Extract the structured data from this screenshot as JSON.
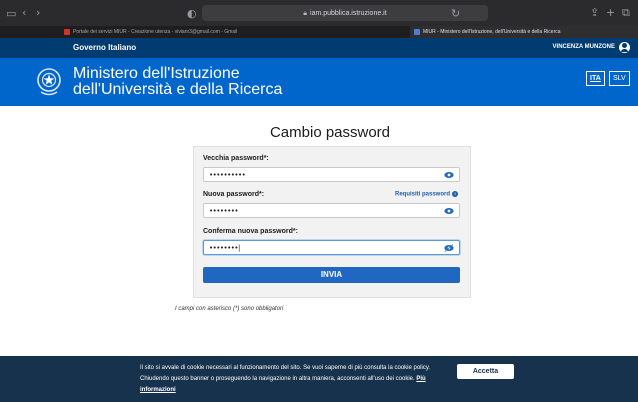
{
  "browser": {
    "url": "iam.pubblica.istruzione.it",
    "tabs": [
      {
        "label": "Portale dei servizi MIUR - Creazione utenza - vivianr3@gmail.com - Gmail",
        "active": false
      },
      {
        "label": "MIUR - Ministero dell'Istruzione, dell'Università e della Ricerca",
        "active": true
      }
    ]
  },
  "gov_bar": {
    "title": "Governo Italiano",
    "user": "VINCENZA MUNZONE"
  },
  "header": {
    "name_line1": "Ministero dell'Istruzione",
    "name_line2": "dell'Università e della Ricerca",
    "languages": [
      "ITA",
      "SLV"
    ]
  },
  "form": {
    "title": "Cambio password",
    "old_password": {
      "label": "Vecchia password*:",
      "value": "••••••••••"
    },
    "new_password": {
      "label": "Nuova password*:",
      "value": "••••••••",
      "hint": "Requisiti password"
    },
    "confirm_password": {
      "label": "Conferma nuova password*:",
      "value": "••••••••|"
    },
    "submit_label": "INVIA",
    "required_note": "I campi con asterisco (*) sono obbligatori"
  },
  "cookie_banner": {
    "text": "Il sito si avvale di cookie necessari al funzionamento del sito. Se vuoi saperne di più consulta la cookie policy. Chiudendo questo banner o proseguendo la navigazione in altra maniera, acconsenti all'uso dei cookie.",
    "link": "Più informazioni",
    "accept_label": "Accetta"
  },
  "colors": {
    "gov_bar": "#003b72",
    "header": "#0066cc",
    "button": "#1f67c0",
    "cookie_bg": "#17324d"
  }
}
